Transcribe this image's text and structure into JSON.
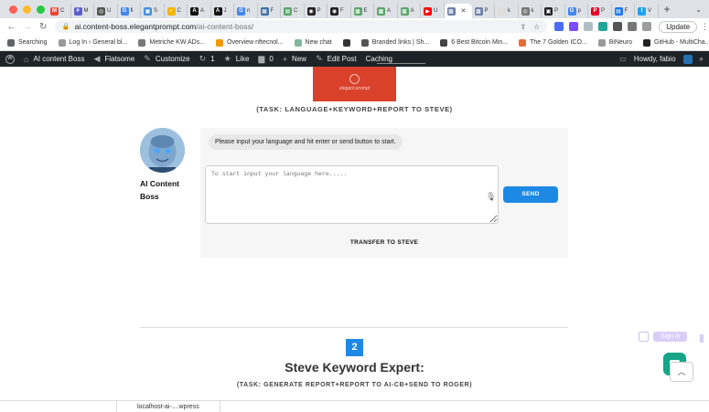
{
  "browser": {
    "traffic_colors": [
      "#ff5f57",
      "#febc2e",
      "#28c840"
    ],
    "tabs": [
      {
        "letter": "M",
        "label": "C",
        "color": "#ea4335"
      },
      {
        "letter": "#",
        "label": "M",
        "color": "#5b5fc7"
      },
      {
        "letter": "◎",
        "label": "U",
        "color": "#555555"
      },
      {
        "letter": "G",
        "label": "fi",
        "color": "#4285f4"
      },
      {
        "letter": "▣",
        "label": "S",
        "color": "#4a90d9"
      },
      {
        "letter": "⚡",
        "label": "C",
        "color": "#f4b400"
      },
      {
        "letter": "A",
        "label": "A",
        "color": "#111111"
      },
      {
        "letter": "A",
        "label": "J",
        "color": "#111111"
      },
      {
        "letter": "G",
        "label": "n",
        "color": "#4285f4"
      },
      {
        "letter": "▦",
        "label": "F",
        "color": "#3b6ea5"
      },
      {
        "letter": "▤",
        "label": "C",
        "color": "#5aa469"
      },
      {
        "letter": "◉",
        "label": "P",
        "color": "#222222"
      },
      {
        "letter": "◉",
        "label": "F",
        "color": "#222222"
      },
      {
        "letter": "▩",
        "label": "E",
        "color": "#5aa469"
      },
      {
        "letter": "▩",
        "label": "A",
        "color": "#5aa469"
      },
      {
        "letter": "▩",
        "label": "A",
        "color": "#5aa469"
      },
      {
        "letter": "▶",
        "label": "U",
        "color": "#ff0000"
      },
      {
        "letter": "▩",
        "label": "",
        "color": "#6b7fa6",
        "active": true
      },
      {
        "letter": "▩",
        "label": "P",
        "color": "#6b7fa6"
      },
      {
        "letter": " ",
        "label": "k",
        "color": "#dddddd"
      },
      {
        "letter": "◎",
        "label": "k",
        "color": "#777777"
      },
      {
        "letter": "▣",
        "label": "P",
        "color": "#222222"
      },
      {
        "letter": "G",
        "label": "p",
        "color": "#4285f4"
      },
      {
        "letter": "P",
        "label": "P",
        "color": "#e60023"
      },
      {
        "letter": "▤",
        "label": "F",
        "color": "#1877f2"
      },
      {
        "letter": "t",
        "label": "V",
        "color": "#1da1f2"
      }
    ],
    "new_tab": "+",
    "url_host": "ai.content-boss.elegantprompt.com",
    "url_path": "/ai-content-boss/",
    "update_label": "Update"
  },
  "bookmarks": [
    {
      "label": "Searching",
      "color": "#5f6368"
    },
    {
      "label": "Log In ‹ General bl...",
      "color": "#999999"
    },
    {
      "label": "Metriche KW ADs...",
      "color": "#777777"
    },
    {
      "label": "Overview nftecnol...",
      "color": "#f29900"
    },
    {
      "label": "New chat",
      "color": "#7fb89e"
    },
    {
      "label": "",
      "color": "#333333"
    },
    {
      "label": "Branded links | Sh...",
      "color": "#555555"
    },
    {
      "label": "6 Best Bitcoin Min...",
      "color": "#444444"
    },
    {
      "label": "The 7 Golden ICO...",
      "color": "#e86b3a"
    },
    {
      "label": "BiNeuro",
      "color": "#999999"
    },
    {
      "label": "GitHub - MultiCha...",
      "color": "#222222"
    }
  ],
  "wp_admin": {
    "site_name": "AI content Boss",
    "theme": "Flatsome",
    "customize": "Customize",
    "updates_count": "1",
    "like": "Like",
    "comments_count": "0",
    "new": "New",
    "edit_post": "Edit Post",
    "caching": "Caching",
    "howdy": "Howdy, fabio"
  },
  "banner": {
    "brand_text": "elegant prompt",
    "color": "#d9412b"
  },
  "section1": {
    "task_line": "(TASK: LANGUAGE+KEYWORD+REPORT TO STEVE)",
    "bot_name": "AI Content Boss",
    "message": "Please input your language and hit enter or send button to start.",
    "input_placeholder": "To start input your language here.....",
    "send_label": "SEND",
    "transfer_label": "TRANSFER TO STEVE"
  },
  "section2": {
    "number": "2",
    "title": "Steve Keyword Expert:",
    "task_line": "(TASK: GENERATE REPORT+REPORT TO AI-CB+SEND TO ROGER)"
  },
  "widgets": {
    "sign_in": "Sign in",
    "scroll_top_icon": "chevron-up-icon"
  },
  "downloads": {
    "item": "localhost-ai-....wpress"
  },
  "colors": {
    "accent": "#1e88e5",
    "wp_bar": "#1d2327",
    "chat_teal": "#17a589"
  }
}
